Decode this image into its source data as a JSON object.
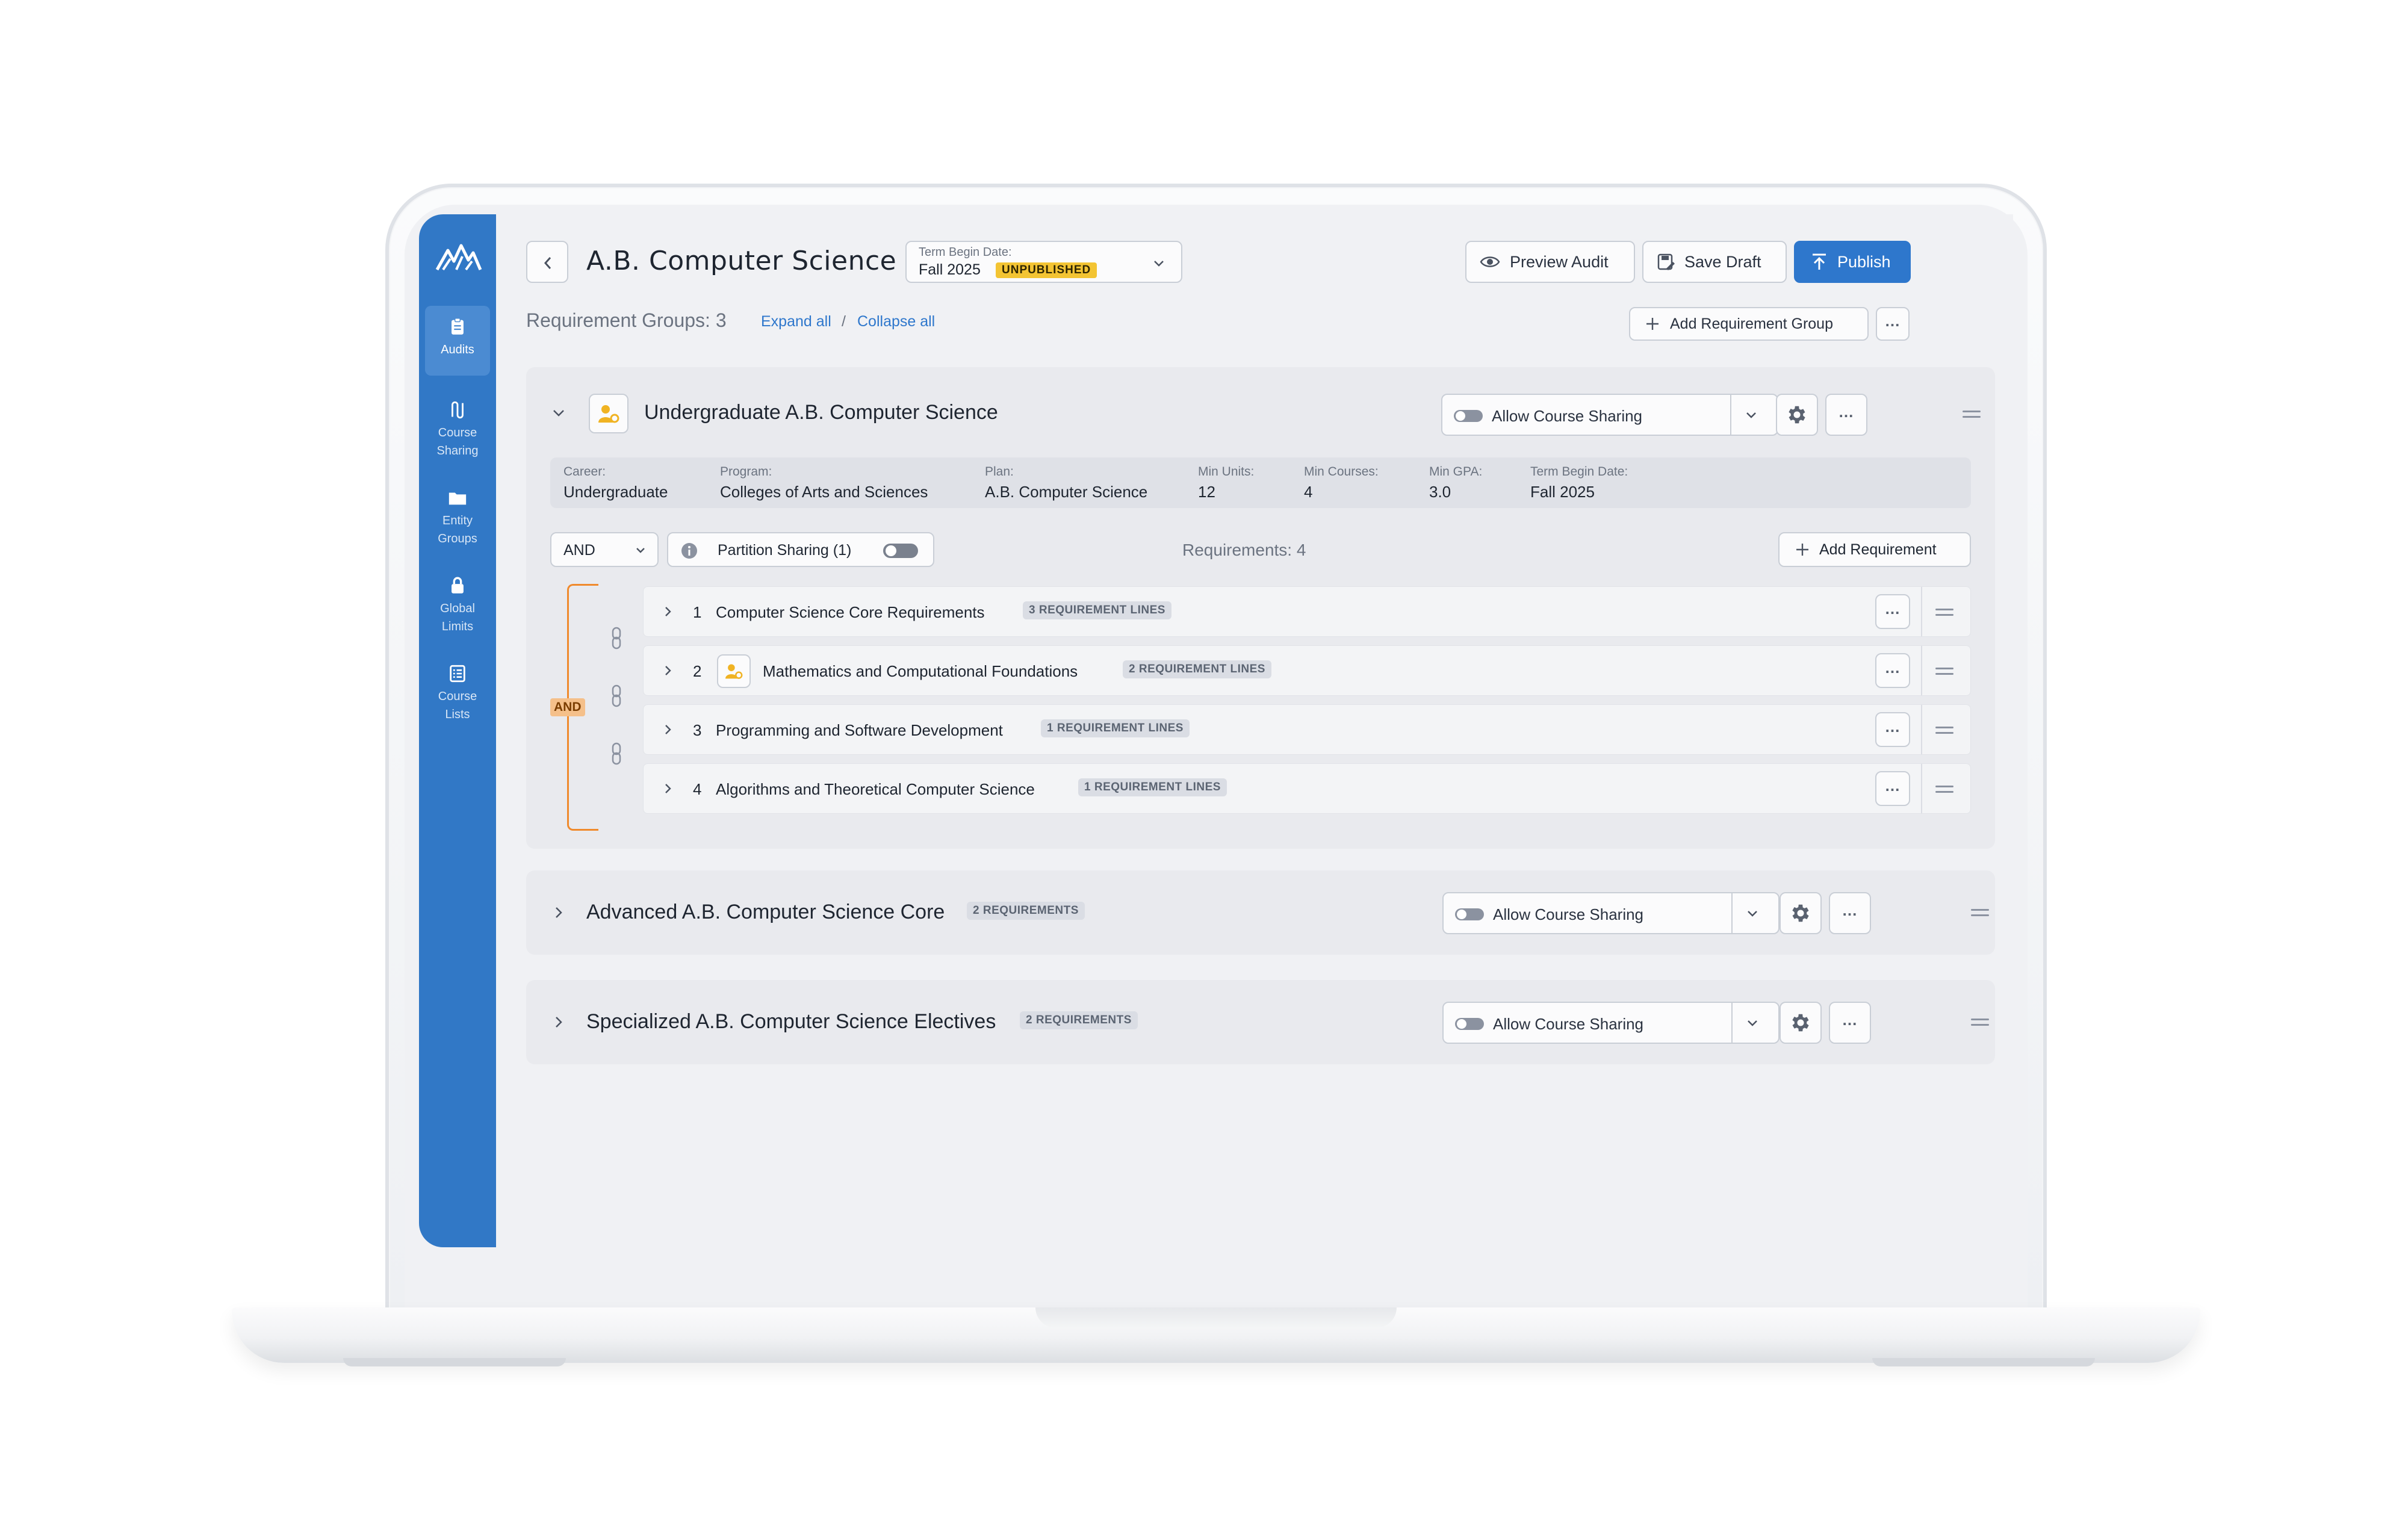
{
  "app": {
    "page_title": "A.B. Computer Science",
    "term": {
      "label": "Term Begin Date:",
      "value": "Fall 2025",
      "status": "UNPUBLISHED"
    },
    "actions": {
      "preview": "Preview Audit",
      "save": "Save Draft",
      "publish": "Publish"
    },
    "groups_count": "Requirement Groups: 3",
    "expand_all": "Expand all",
    "slash": "/",
    "collapse_all": "Collapse all",
    "add_group": "Add Requirement Group"
  },
  "sidebar": {
    "items": [
      {
        "label1": "Audits",
        "label2": "",
        "icon": "clipboard-icon",
        "active": true
      },
      {
        "label1": "Course",
        "label2": "Sharing",
        "icon": "route-icon",
        "active": false
      },
      {
        "label1": "Entity",
        "label2": "Groups",
        "icon": "folder-icon",
        "active": false
      },
      {
        "label1": "Global",
        "label2": "Limits",
        "icon": "lock-icon",
        "active": false
      },
      {
        "label1": "Course",
        "label2": "Lists",
        "icon": "list-icon",
        "active": false
      }
    ]
  },
  "groups": [
    {
      "title": "Undergraduate A.B. Computer Science",
      "sharing": "Allow Course Sharing",
      "info": [
        {
          "k": "Career:",
          "v": "Undergraduate"
        },
        {
          "k": "Program:",
          "v": "Colleges of Arts and Sciences"
        },
        {
          "k": "Plan:",
          "v": "A.B. Computer Science"
        },
        {
          "k": "Min Units:",
          "v": "12"
        },
        {
          "k": "Min Courses:",
          "v": "4"
        },
        {
          "k": "Min GPA:",
          "v": "3.0"
        },
        {
          "k": "Term Begin Date:",
          "v": "Fall 2025"
        }
      ],
      "logic": "AND",
      "partition": "Partition Sharing (1)",
      "requirements_count": "Requirements: 4",
      "add_requirement": "Add Requirement",
      "bracket_label": "AND",
      "requirements": [
        {
          "num": "1",
          "title": "Computer Science Core Requirements",
          "lines": "3 REQUIREMENT LINES"
        },
        {
          "num": "2",
          "title": "Mathematics and Computational Foundations",
          "lines": "2 REQUIREMENT LINES"
        },
        {
          "num": "3",
          "title": "Programming and Software Development",
          "lines": "1 REQUIREMENT LINES"
        },
        {
          "num": "4",
          "title": "Algorithms and Theoretical Computer Science",
          "lines": "1 REQUIREMENT LINES"
        }
      ]
    },
    {
      "title": "Advanced A.B. Computer Science Core",
      "count": "2 REQUIREMENTS",
      "sharing": "Allow Course Sharing"
    },
    {
      "title": "Specialized A.B. Computer Science Electives",
      "count": "2 REQUIREMENTS",
      "sharing": "Allow Course Sharing"
    }
  ],
  "colors": {
    "primary": "#2e77cc",
    "sidebar": "#3178c6",
    "badge": "#f3c433",
    "bracket": "#f08a2c"
  }
}
